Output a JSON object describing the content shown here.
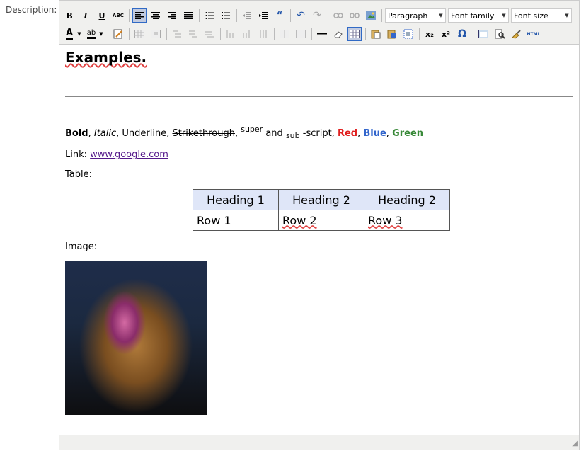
{
  "form": {
    "description_label": "Description:"
  },
  "toolbar": {
    "row1": {
      "bold": "B",
      "italic": "I",
      "underline": "U",
      "strike": "ABC",
      "block_format": "Paragraph",
      "font_family": "Font family",
      "font_size": "Font size"
    },
    "row2": {
      "text_color": "A",
      "highlight": "ab",
      "subscript": "x₂",
      "superscript": "x²",
      "omega": "Ω",
      "html": "HTML"
    }
  },
  "content": {
    "heading": "Examples.",
    "format_line": {
      "bold": "Bold",
      "sep1": ", ",
      "italic": "Italic",
      "sep2": ", ",
      "underline": "Underline",
      "sep3": ", ",
      "strike": "Strikethrough",
      "sep4": ", ",
      "super": "super",
      "and": " and ",
      "sub": "sub",
      "script": " -script, ",
      "red": "Red",
      "sep5": ", ",
      "blue": "Blue",
      "sep6": ", ",
      "green": "Green"
    },
    "link_label": "Link: ",
    "link_text": "www.google.com",
    "table_label": "Table:",
    "table": {
      "headers": [
        "Heading 1",
        "Heading 2",
        "Heading 2"
      ],
      "rows": [
        [
          "Row 1",
          "Row 2",
          "Row 3"
        ]
      ]
    },
    "image_label": "Image:"
  },
  "colors": {
    "red": "#e02020",
    "blue": "#3366cc",
    "green": "#3a8a3a",
    "toolbar_bg": "#f0f0ee",
    "table_header_bg": "#dfe6f8"
  }
}
